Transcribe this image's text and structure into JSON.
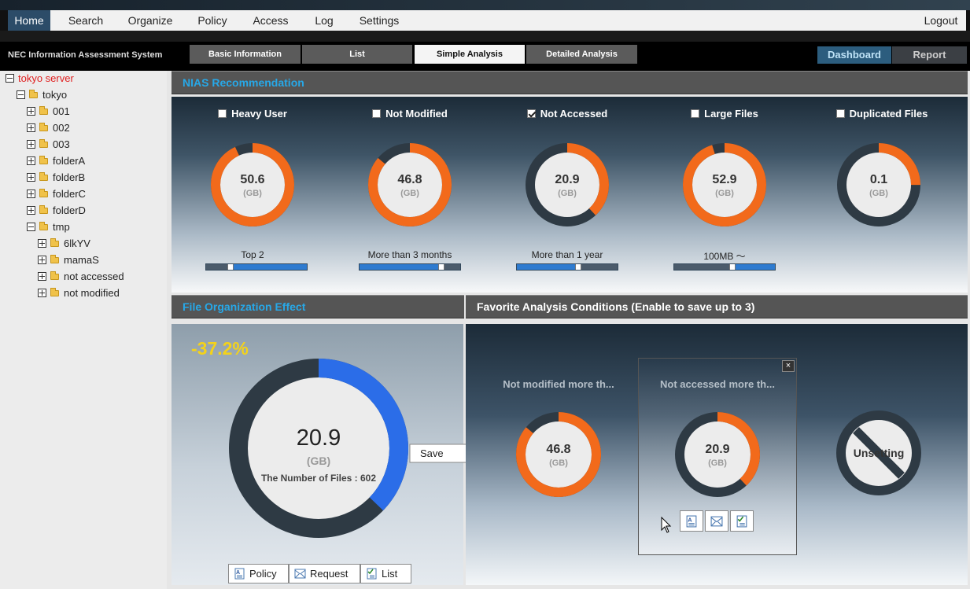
{
  "menu": {
    "items": [
      "Home",
      "Search",
      "Organize",
      "Policy",
      "Access",
      "Log",
      "Settings"
    ],
    "logout": "Logout"
  },
  "app_title": "NEC Information Assessment System",
  "tabs": [
    "Basic Information",
    "List",
    "Simple Analysis",
    "Detailed Analysis"
  ],
  "right_tabs": [
    "Dashboard",
    "Report"
  ],
  "tree": {
    "root": "tokyo server",
    "child": "tokyo",
    "folders": [
      "001",
      "002",
      "003",
      "folderA",
      "folderB",
      "folderC",
      "folderD",
      "tmp"
    ],
    "tmp_children": [
      "6lkYV",
      "mamaS",
      "not accessed",
      "not modified"
    ]
  },
  "recommendation": {
    "title": "NIAS Recommendation",
    "unit": "(GB)",
    "tiles": [
      {
        "label": "Heavy User",
        "checked": false,
        "value": "50.6",
        "fraction": 0.93,
        "slider_label": "Top 2",
        "slider_pos": 0.24
      },
      {
        "label": "Not Modified",
        "checked": false,
        "value": "46.8",
        "fraction": 0.86,
        "slider_label": "More than 3 months",
        "slider_pos": 0.81
      },
      {
        "label": "Not Accessed",
        "checked": true,
        "value": "20.9",
        "fraction": 0.38,
        "slider_label": "More than 1 year",
        "slider_pos": 0.61
      },
      {
        "label": "Large Files",
        "checked": false,
        "value": "52.9",
        "fraction": 0.95,
        "slider_label": "100MB 〜",
        "slider_pos": 0.58
      },
      {
        "label": "Duplicated Files",
        "checked": false,
        "value": "0.1",
        "fraction": 0.25,
        "slider_label": "",
        "slider_pos": null
      }
    ]
  },
  "effect": {
    "title": "File Organization Effect",
    "percent": "-37.2%",
    "value": "20.9",
    "unit": "(GB)",
    "files_text": "The Number of Files : 602",
    "fraction": 0.372,
    "save_label": "Save",
    "buttons": [
      "Policy",
      "Request",
      "List"
    ]
  },
  "favorites": {
    "title": "Favorite Analysis Conditions (Enable to save up to 3)",
    "items": [
      {
        "title": "Not modified more th...",
        "value": "46.8",
        "fraction": 0.86
      },
      {
        "title": "Not accessed more th...",
        "value": "20.9",
        "fraction": 0.38
      }
    ],
    "unit": "(GB)",
    "close": "×",
    "unset_label": "Unsetting"
  },
  "colors": {
    "orange": "#f26a1b",
    "dark": "#2e3a44",
    "blue": "#2b6de8",
    "accent": "#1aa3e8",
    "highlight": "#f3d21b",
    "tree_root": "#e02020"
  }
}
